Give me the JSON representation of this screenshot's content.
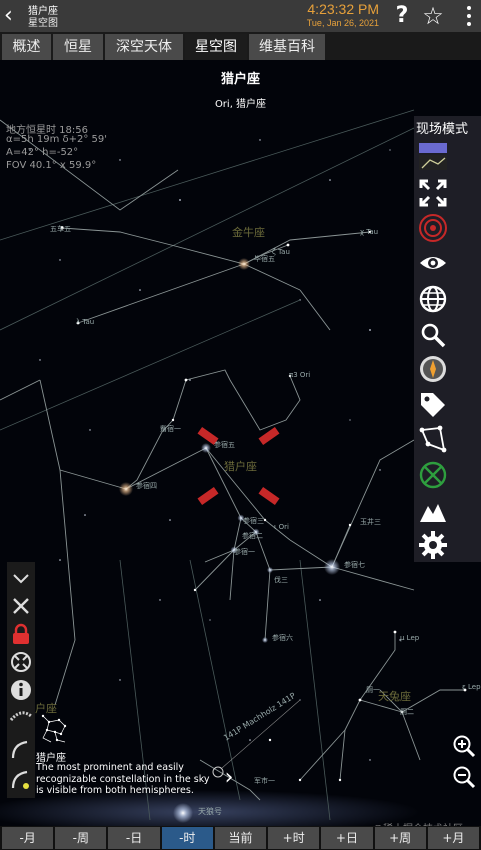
{
  "header": {
    "title": "猎户座",
    "subtitle": "星空图",
    "time": "4:23:32 PM",
    "date": "Tue, Jan 26, 2021",
    "help_icon": "help-icon",
    "star_icon": "star-outline-icon",
    "more_icon": "more-vertical-icon",
    "accent_color": "#e6a03a"
  },
  "tabs": [
    {
      "label": "概述"
    },
    {
      "label": "恒星"
    },
    {
      "label": "深空天体"
    },
    {
      "label": "星空图",
      "active": true
    },
    {
      "label": "维基百科"
    }
  ],
  "sky": {
    "constellation_title": "猎户座",
    "constellation_subtitle": "Ori, 猎户座",
    "info": {
      "sidereal": "地方恒星时 18:56",
      "radec": "α=5h 19m  δ+2° 59'",
      "altaz": "A=42° h=-52°",
      "fov": "FOV 40.1° x 59.9°"
    },
    "labels": {
      "taurus": "金牛座",
      "orion": "猎户座",
      "monoceros": "天兔座",
      "orion_side": "猎户座",
      "comet": "141P Machholz 141P",
      "galaxy": "天狼号"
    },
    "stars": {
      "s1": "五车五",
      "s2": "χ Tau",
      "s3": "ζ Tau",
      "s4": "毕宿五",
      "s5": "λ Tau",
      "s6": "π3 Ori",
      "s7": "觜宿一",
      "s8": "参宿五",
      "s9": "参宿四",
      "s10": "参宿三",
      "s11": "参宿二",
      "s12": "参宿一",
      "s13": "ι Ori",
      "s14": "伐三",
      "s15": "玉井三",
      "s16": "参宿七",
      "s17": "参宿六",
      "s18": "μ Lep",
      "s19": "厕一",
      "s20": "厕二",
      "s21": "ε Lep",
      "s22": "军市一",
      "s23": "μ Lep"
    }
  },
  "tools": {
    "mode_label": "现场模式",
    "items": [
      "field-of-view-icon",
      "fullscreen-icon",
      "target-icon",
      "eye-icon",
      "globe-icon",
      "search-icon",
      "compass-icon",
      "tag-icon",
      "constellation-lines-icon",
      "no-target-icon",
      "horizon-icon",
      "settings-icon"
    ]
  },
  "left_tools": [
    "collapse-icon",
    "close-icon",
    "lock-icon",
    "crosshair-icon",
    "info-icon",
    "comet-icon",
    "orbit-icon",
    "orbit-dot-icon"
  ],
  "popup": {
    "name": "猎户座",
    "description": "The most prominent and easily recognizable constellation in the sky is visible from both hemispheres."
  },
  "watermark": "@稀土掘金技术社区",
  "bottom_bar": [
    {
      "label": "-月"
    },
    {
      "label": "-周"
    },
    {
      "label": "-日"
    },
    {
      "label": "-时",
      "active": true
    },
    {
      "label": "当前"
    },
    {
      "label": "+时"
    },
    {
      "label": "+日"
    },
    {
      "label": "+周"
    },
    {
      "label": "+月"
    }
  ]
}
